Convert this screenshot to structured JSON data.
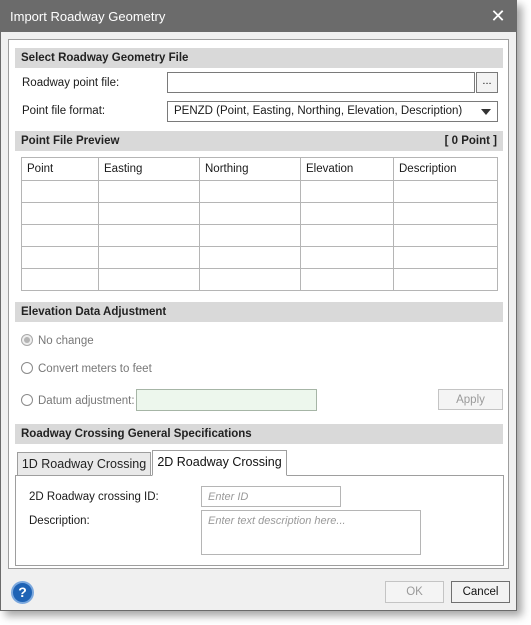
{
  "window": {
    "title": "Import Roadway Geometry",
    "close_glyph": "✕"
  },
  "select_section": {
    "header": "Select Roadway Geometry File",
    "point_file_label": "Roadway point file:",
    "point_file_value": "",
    "browse_label": "...",
    "format_label": "Point file format:",
    "format_value": "PENZD (Point, Easting, Northing, Elevation, Description)"
  },
  "preview_section": {
    "header": "Point File Preview",
    "count_label": "[ 0 Point ]",
    "columns": [
      "Point",
      "Easting",
      "Northing",
      "Elevation",
      "Description"
    ],
    "rows": [
      [
        "",
        "",
        "",
        "",
        ""
      ],
      [
        "",
        "",
        "",
        "",
        ""
      ],
      [
        "",
        "",
        "",
        "",
        ""
      ],
      [
        "",
        "",
        "",
        "",
        ""
      ],
      [
        "",
        "",
        "",
        "",
        ""
      ]
    ]
  },
  "elevation_section": {
    "header": "Elevation Data Adjustment",
    "option_no_change": "No change",
    "option_convert": "Convert meters to feet",
    "option_datum": "Datum adjustment:",
    "datum_value": "",
    "apply_label": "Apply",
    "selected": "No change"
  },
  "crossing_section": {
    "header": "Roadway Crossing General Specifications",
    "tabs": [
      {
        "label": "1D Roadway Crossing",
        "active": false
      },
      {
        "label": "2D Roadway Crossing",
        "active": true
      }
    ],
    "id_label": "2D Roadway crossing ID:",
    "id_placeholder": "Enter ID",
    "description_label": "Description:",
    "description_placeholder": "Enter text description here..."
  },
  "footer": {
    "help_glyph": "?",
    "ok_label": "OK",
    "cancel_label": "Cancel"
  },
  "colors": {
    "titlebar": "#6b6b6b",
    "section_header": "#d9d9d9",
    "help_button": "#1f63b5",
    "datum_field": "#edf7ed"
  },
  "icons": {
    "close": "close-icon",
    "dropdown": "chevron-down-icon",
    "help": "help-icon"
  }
}
